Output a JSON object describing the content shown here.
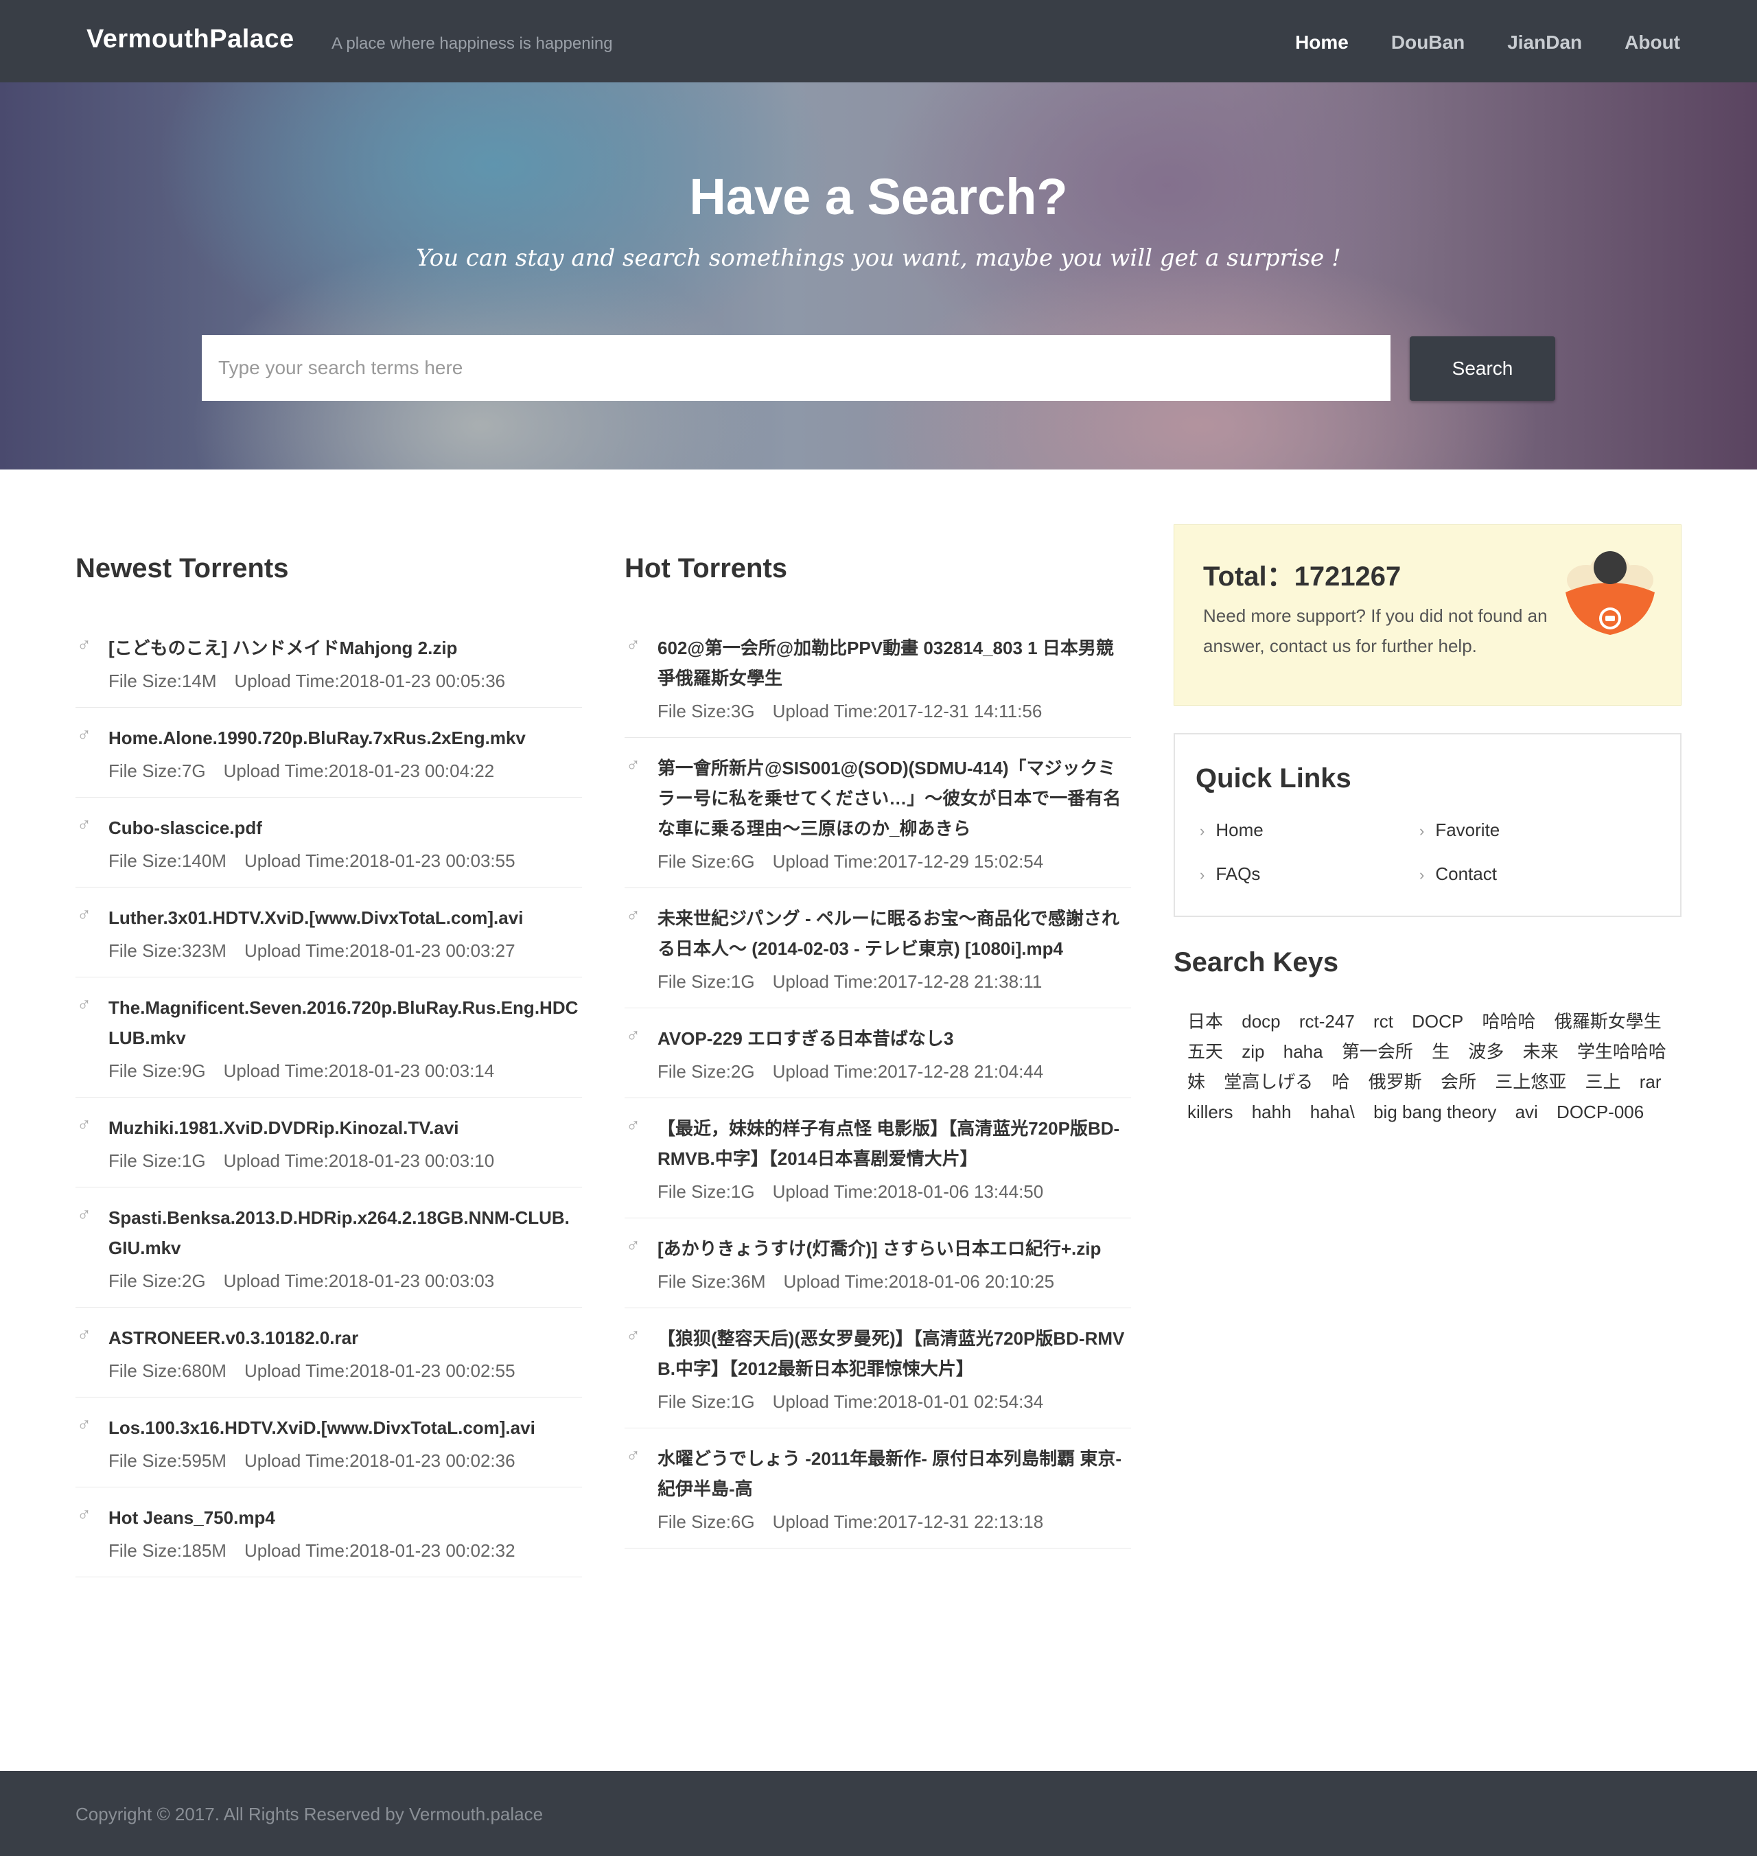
{
  "header": {
    "brand": "VermouthPalace",
    "tagline": "A place where happiness is happening",
    "nav": [
      "Home",
      "DouBan",
      "JianDan",
      "About"
    ]
  },
  "hero": {
    "title": "Have a Search?",
    "subtitle": "You can stay and search somethings you want, maybe you will get a surprise !",
    "search_placeholder": "Type your search terms here",
    "search_button": "Search"
  },
  "newest": {
    "title": "Newest Torrents",
    "items": [
      {
        "name": "[こどものこえ] ハンドメイドMahjong 2.zip",
        "size": "File Size:14M",
        "time": "Upload Time:2018-01-23 00:05:36"
      },
      {
        "name": "Home.Alone.1990.720p.BluRay.7xRus.2xEng.mkv",
        "size": "File Size:7G",
        "time": "Upload Time:2018-01-23 00:04:22"
      },
      {
        "name": "Cubo-slascice.pdf",
        "size": "File Size:140M",
        "time": "Upload Time:2018-01-23 00:03:55"
      },
      {
        "name": "Luther.3x01.HDTV.XviD.[www.DivxTotaL.com].avi",
        "size": "File Size:323M",
        "time": "Upload Time:2018-01-23 00:03:27"
      },
      {
        "name": "The.Magnificent.Seven.2016.720p.BluRay.Rus.Eng.HDCLUB.mkv",
        "size": "File Size:9G",
        "time": "Upload Time:2018-01-23 00:03:14"
      },
      {
        "name": "Muzhiki.1981.XviD.DVDRip.Kinozal.TV.avi",
        "size": "File Size:1G",
        "time": "Upload Time:2018-01-23 00:03:10"
      },
      {
        "name": "Spasti.Benksa.2013.D.HDRip.x264.2.18GB.NNM-CLUB.GIU.mkv",
        "size": "File Size:2G",
        "time": "Upload Time:2018-01-23 00:03:03"
      },
      {
        "name": "ASTRONEER.v0.3.10182.0.rar",
        "size": "File Size:680M",
        "time": "Upload Time:2018-01-23 00:02:55"
      },
      {
        "name": "Los.100.3x16.HDTV.XviD.[www.DivxTotaL.com].avi",
        "size": "File Size:595M",
        "time": "Upload Time:2018-01-23 00:02:36"
      },
      {
        "name": "Hot Jeans_750.mp4",
        "size": "File Size:185M",
        "time": "Upload Time:2018-01-23 00:02:32"
      }
    ]
  },
  "hot": {
    "title": "Hot Torrents",
    "items": [
      {
        "name": "602@第一会所@加勒比PPV動畫 032814_803 1 日本男競爭俄羅斯女學生",
        "size": "File Size:3G",
        "time": "Upload Time:2017-12-31 14:11:56"
      },
      {
        "name": "第一會所新片@SIS001@(SOD)(SDMU-414)「マジックミラー号に私を乗せてください…」～彼女が日本で一番有名な車に乗る理由～三原ほのか_柳あきら",
        "size": "File Size:6G",
        "time": "Upload Time:2017-12-29 15:02:54"
      },
      {
        "name": "未来世紀ジパング - ペルーに眠るお宝～商品化で感謝される日本人～ (2014-02-03 - テレビ東京) [1080i].mp4",
        "size": "File Size:1G",
        "time": "Upload Time:2017-12-28 21:38:11"
      },
      {
        "name": "AVOP-229 エロすぎる日本昔ばなし3",
        "size": "File Size:2G",
        "time": "Upload Time:2017-12-28 21:04:44"
      },
      {
        "name": "【最近，妹妹的样子有点怪 电影版】【高清蓝光720P版BD-RMVB.中字】【2014日本喜剧爱情大片】",
        "size": "File Size:1G",
        "time": "Upload Time:2018-01-06 13:44:50"
      },
      {
        "name": "[あかりきょうすけ(灯喬介)] さすらい日本エロ紀行+.zip",
        "size": "File Size:36M",
        "time": "Upload Time:2018-01-06 20:10:25"
      },
      {
        "name": "【狼狈(整容天后)(恶女罗曼死)】【高清蓝光720P版BD-RMVB.中字】【2012最新日本犯罪惊悚大片】",
        "size": "File Size:1G",
        "time": "Upload Time:2018-01-01 02:54:34"
      },
      {
        "name": "水曜どうでしょう -2011年最新作- 原付日本列島制覇 東京-紀伊半島-高",
        "size": "File Size:6G",
        "time": "Upload Time:2017-12-31 22:13:18"
      }
    ]
  },
  "total": {
    "title": "Total：1721267",
    "text": "Need more support? If you did not found an answer, contact us for further help.",
    "icon": "support-agent-icon"
  },
  "quick_links": {
    "title": "Quick Links",
    "items": [
      "Home",
      "Favorite",
      "FAQs",
      "Contact"
    ]
  },
  "search_keys": {
    "title": "Search Keys",
    "keys": [
      "日本",
      "docp",
      "rct-247",
      "rct",
      "DOCP",
      "哈哈哈",
      "俄羅斯女學生",
      "五天",
      "zip",
      "haha",
      "第一会所",
      "生",
      "波多",
      "未来",
      "学生哈哈哈",
      "妹",
      "堂高しげる",
      "哈",
      "俄罗斯",
      "会所",
      "三上悠亚",
      "三上",
      "rar",
      "killers",
      "hahh",
      "haha\\",
      "big bang theory",
      "avi",
      "DOCP-006"
    ]
  },
  "footer": {
    "copyright": "Copyright © 2017. All Rights Reserved by Vermouth.palace"
  },
  "colors": {
    "navbar": "#393e46",
    "total_box": "#fcf8d8",
    "accent_orange": "#f26a2e"
  }
}
